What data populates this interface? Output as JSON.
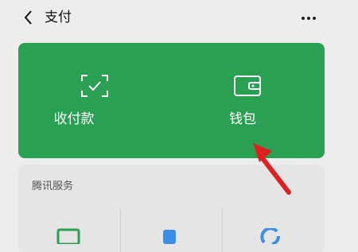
{
  "header": {
    "title": "支付"
  },
  "pay_card": {
    "receive_label": "收付款",
    "wallet_label": "钱包"
  },
  "services": {
    "title": "腾讯服务"
  },
  "colors": {
    "card_green": "#2aa053",
    "annotation_arrow": "#e02020",
    "background": "#ededed"
  },
  "icons": [
    "back-icon",
    "more-icon",
    "scan-icon",
    "wallet-icon",
    "card-icon",
    "phone-icon",
    "refresh-icon"
  ]
}
